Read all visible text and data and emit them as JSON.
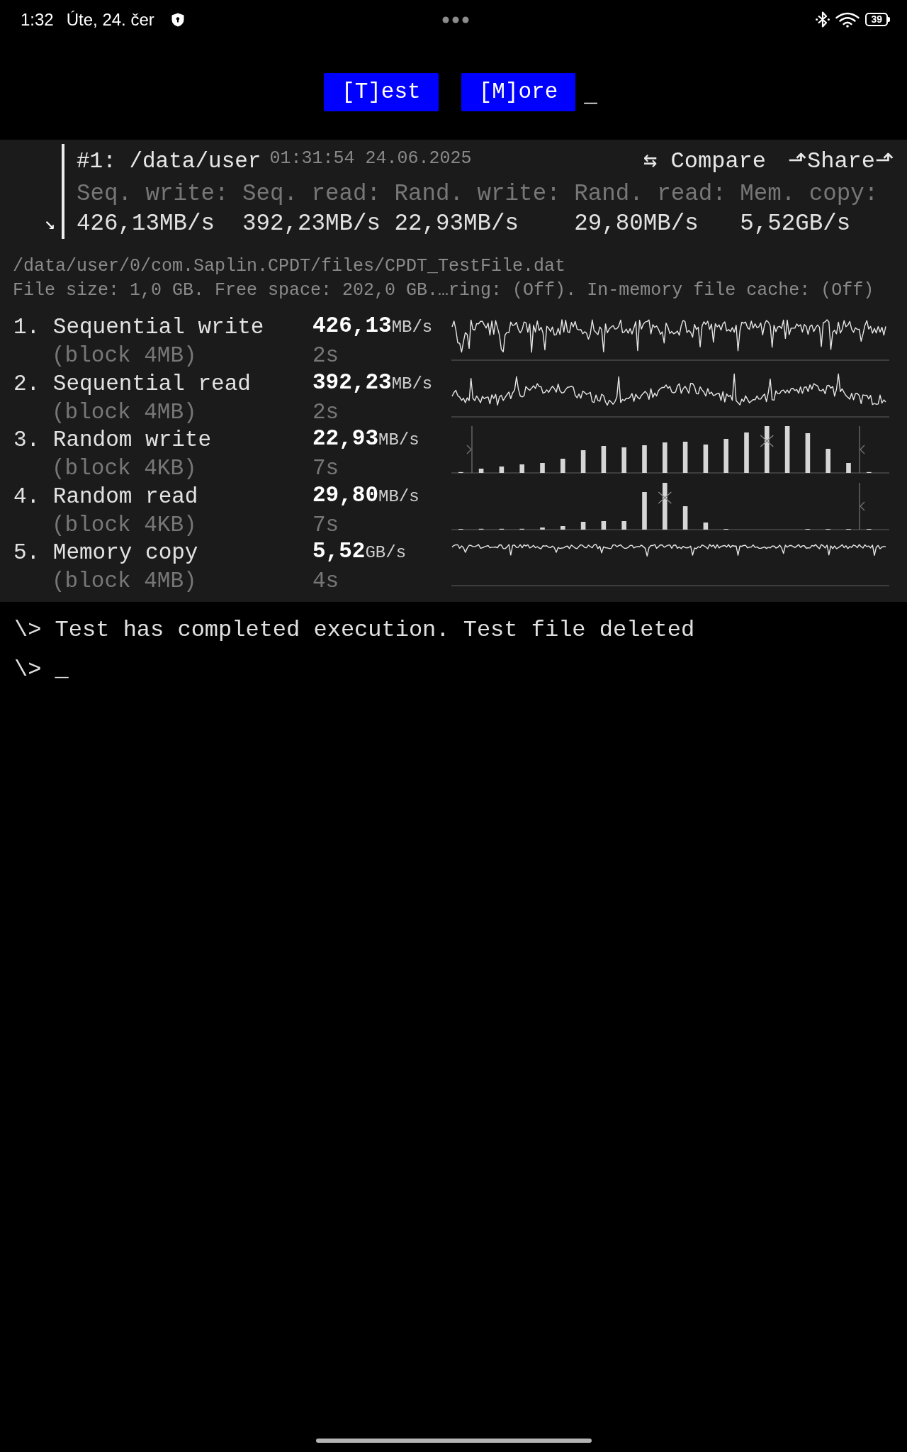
{
  "status_bar": {
    "time": "1:32",
    "date": "Úte, 24. čer",
    "battery": "39"
  },
  "menu": {
    "buttons": [
      {
        "label": "[T]est"
      },
      {
        "label": "[M]ore"
      }
    ],
    "cursor": "_"
  },
  "result": {
    "toggle": "↘",
    "title": "#1: /data/user",
    "timestamp": "01:31:54 24.06.2025",
    "actions": [
      {
        "label": "⇆ Compare"
      },
      {
        "label": "⬏Share⬏"
      }
    ],
    "summary": [
      {
        "label": "Seq. write:",
        "value": "426,13MB/s"
      },
      {
        "label": "Seq. read:",
        "value": "392,23MB/s"
      },
      {
        "label": "Rand. write:",
        "value": "22,93MB/s"
      },
      {
        "label": "Rand. read:",
        "value": "29,80MB/s"
      },
      {
        "label": "Mem. copy:",
        "value": "5,52GB/s"
      }
    ]
  },
  "file": {
    "path": "/data/user/0/com.Saplin.CPDT/files/CPDT_TestFile.dat",
    "info": "File size: 1,0 GB. Free space: 202,0 GB.…ring: (Off). In-memory file cache: (Off)"
  },
  "tests": [
    {
      "kind": "line",
      "title": "1. Sequential write",
      "block": "(block 4MB)",
      "speed": "**426,13**MB/s",
      "duration": "2s"
    },
    {
      "kind": "line",
      "title": "2. Sequential read",
      "block": "(block 4MB)",
      "speed": "**392,23**MB/s",
      "duration": "2s"
    },
    {
      "kind": "histogram",
      "title": "3. Random write",
      "block": "(block 4KB)",
      "speed": "**22,93**MB/s",
      "duration": "7s"
    },
    {
      "kind": "histogram",
      "title": "4. Random read",
      "block": "(block 4KB)",
      "speed": "**29,80**MB/s",
      "duration": "7s"
    },
    {
      "kind": "line",
      "title": "5. Memory copy",
      "block": "(block 4MB)",
      "speed": "**5,52**GB/s",
      "duration": "4s"
    }
  ],
  "console": {
    "lines": [
      "\\> Test has completed execution. Test file deleted"
    ],
    "prompt": "\\> _"
  }
}
